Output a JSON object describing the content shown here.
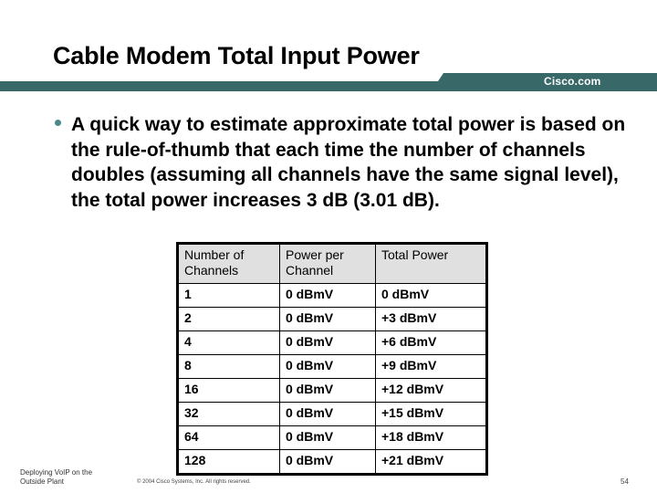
{
  "header": {
    "title": "Cable Modem Total Input Power",
    "brand": "Cisco.com",
    "accent_color": "#386868"
  },
  "body": {
    "bullets": [
      "A quick way to estimate approximate total power is based on the rule-of-thumb that each time the number of channels doubles (assuming all channels have the same signal level), the total power increases 3 dB (3.01 dB)."
    ]
  },
  "table": {
    "headers": [
      "Number of Channels",
      "Power per Channel",
      "Total Power"
    ],
    "rows": [
      [
        "1",
        "0 dBmV",
        "0 dBmV"
      ],
      [
        "2",
        "0 dBmV",
        "+3 dBmV"
      ],
      [
        "4",
        "0 dBmV",
        "+6 dBmV"
      ],
      [
        "8",
        "0 dBmV",
        "+9 dBmV"
      ],
      [
        "16",
        "0 dBmV",
        "+12 dBmV"
      ],
      [
        "32",
        "0 dBmV",
        "+15 dBmV"
      ],
      [
        "64",
        "0 dBmV",
        "+18 dBmV"
      ],
      [
        "128",
        "0 dBmV",
        "+21 dBmV"
      ]
    ]
  },
  "footer": {
    "course_line1": "Deploying VoIP on the",
    "course_line2": "Outside Plant",
    "copyright": "© 2004 Cisco Systems, Inc. All rights reserved.",
    "page_number": "54"
  }
}
